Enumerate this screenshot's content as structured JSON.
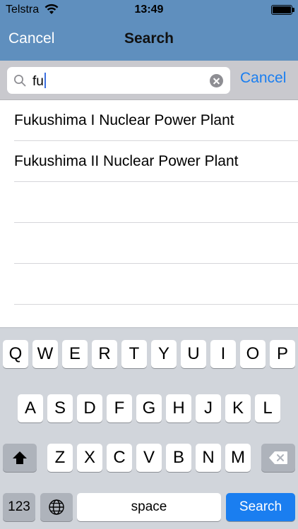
{
  "status_bar": {
    "carrier": "Telstra",
    "time": "13:49",
    "wifi_icon": "wifi-icon",
    "battery_icon": "battery-icon"
  },
  "nav": {
    "cancel_label": "Cancel",
    "title": "Search",
    "background_color": "#5f8fbe"
  },
  "search": {
    "value": "fu",
    "cancel_label": "Cancel",
    "accent_color": "#1a7ef0"
  },
  "results": [
    {
      "label": "Fukushima I Nuclear Power Plant"
    },
    {
      "label": "Fukushima II Nuclear Power Plant"
    },
    {
      "label": ""
    },
    {
      "label": ""
    },
    {
      "label": ""
    }
  ],
  "keyboard": {
    "row1": [
      "Q",
      "W",
      "E",
      "R",
      "T",
      "Y",
      "U",
      "I",
      "O",
      "P"
    ],
    "row2": [
      "A",
      "S",
      "D",
      "F",
      "G",
      "H",
      "J",
      "K",
      "L"
    ],
    "row3": [
      "Z",
      "X",
      "C",
      "V",
      "B",
      "N",
      "M"
    ],
    "numbers_label": "123",
    "space_label": "space",
    "search_label": "Search",
    "shift_icon": "shift-icon",
    "globe_icon": "globe-icon",
    "backspace_icon": "backspace-icon"
  }
}
